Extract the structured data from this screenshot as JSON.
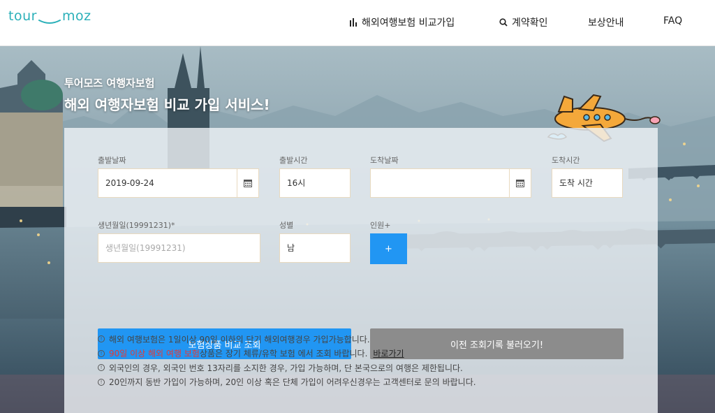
{
  "header": {
    "logo_left": "tour",
    "logo_right": "moz",
    "nav": {
      "compare": "해외여행보험 비교가입",
      "contract": "계약확인",
      "claim": "보상안내",
      "faq": "FAQ"
    }
  },
  "hero": {
    "subtitle": "투어모즈 여행자보험",
    "title": "해외 여행자보험 비교 가입 서비스!"
  },
  "form": {
    "depart_date": {
      "label": "출발날짜",
      "value": "2019-09-24"
    },
    "depart_time": {
      "label": "출발시간",
      "value": "16시"
    },
    "arrive_date": {
      "label": "도착날짜",
      "value": ""
    },
    "arrive_time": {
      "label": "도착시간",
      "placeholder": "도착 시간"
    },
    "birth": {
      "label": "생년월일(19991231)*",
      "placeholder": "생년월일(19991231)"
    },
    "gender": {
      "label": "성별",
      "value": "남"
    },
    "people": {
      "label": "인원+",
      "button": "+"
    },
    "compare_button": "보험상품 비교 조회",
    "history_button": "이전 조회기록 불러오기!"
  },
  "notes": {
    "n1": "해외 여행보험은 1일이상 90일 이하의 단기 해외여행경우 가입가능합니다.",
    "n2_red": "90일 이상 해외 여행 보험",
    "n2_rest": " 상품은 장기 체류/유학 보험 에서 조회 바랍니다.",
    "n2_link": "바로가기",
    "n3": "외국인의 경우, 외국인 번호 13자리를 소지한 경우, 가입 가능하며, 단 본국으로의 여행은 제한됩니다.",
    "n4": "20인까지 동반 가입이 가능하며, 20인 이상 혹은 단체 가입이 어려우신경우는 고객센터로 문의 바랍니다."
  },
  "colors": {
    "brand": "#2bb0b9",
    "primary": "#2196f3",
    "secondary": "#8c8c8c",
    "warning": "#e53935",
    "field_border": "#e8d9bf"
  },
  "icons": {
    "compare": "bar-chart-icon",
    "contract": "search-icon",
    "calendar": "calendar-icon",
    "note": "info-circle-icon",
    "plane": "airplane-illustration"
  }
}
